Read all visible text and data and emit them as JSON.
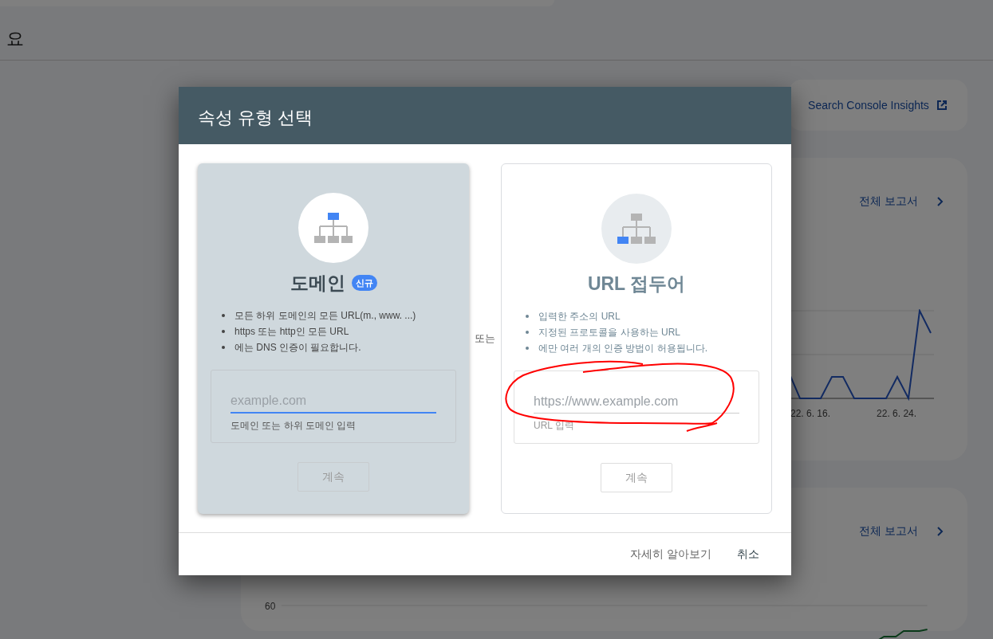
{
  "page": {
    "title": "요",
    "insights_link": "Search Console Insights",
    "cards": [
      {
        "link": "전체 보고서",
        "chart": {
          "kind": "clicks",
          "x_labels": [
            "22. 6. 16.",
            "22. 6. 24."
          ]
        }
      },
      {
        "link": "전체 보고서",
        "chart": {
          "kind": "pages",
          "y_labels": [
            "60"
          ]
        }
      }
    ]
  },
  "dialog": {
    "title": "속성 유형 선택",
    "separator": "또는",
    "options": [
      {
        "title": "도메인",
        "badge": "신규",
        "selected": true,
        "kind": "domain",
        "circled": false,
        "bullets": [
          "모든 하위 도메인의 모든 URL(m., www. ...)",
          "https 또는 http인 모든 URL",
          "에는 DNS 인증이 필요합니다."
        ],
        "field": {
          "placeholder": "example.com",
          "helper": "도메인 또는 하위 도메인 입력",
          "focused": true
        },
        "button": {
          "label": "계속",
          "disabled": true
        }
      },
      {
        "title": "URL 접두어",
        "selected": false,
        "kind": "prefix",
        "circled": true,
        "bullets": [
          "입력한 주소의 URL",
          "지정된 프로토콜을 사용하는 URL",
          "에만 여러 개의 인증 방법이 허용됩니다."
        ],
        "field": {
          "placeholder": "https://www.example.com",
          "helper": "URL 입력",
          "focused": false
        },
        "button": {
          "label": "계속",
          "disabled": true
        }
      }
    ],
    "footer_buttons": [
      "자세히 알아보기",
      "취소"
    ]
  }
}
